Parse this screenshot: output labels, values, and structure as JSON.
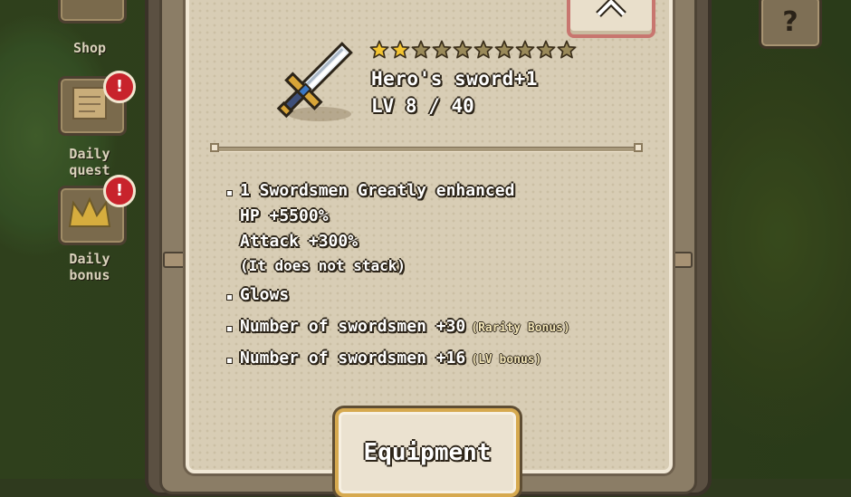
{
  "side_menu": {
    "shop_label": "Shop",
    "daily_quest_label": "Daily quest",
    "daily_bonus_label": "Daily bonus",
    "badge_text": "!"
  },
  "help_button": {
    "label": "?"
  },
  "item": {
    "name": "Hero's sword+1",
    "level": "LV 8 / 40",
    "stars_filled": 2,
    "stars_total": 10
  },
  "effects": {
    "effect1_title": "1 Swordsmen Greatly enhanced",
    "effect1_hp": "HP +5500%",
    "effect1_attack": "Attack +300%",
    "effect1_note": "(It does not stack)",
    "effect2": "Glows",
    "effect3": "Number of swordsmen +30",
    "effect3_bonus": "(Rarity Bonus)",
    "effect4": "Number of swordsmen +16",
    "effect4_bonus": "(LV bonus)"
  },
  "equip_button": {
    "label": "Equipment"
  },
  "colors": {
    "star_filled": "#f4c531",
    "star_empty": "#9a8a5a",
    "badge": "#c8232c",
    "close_border": "#c8766f",
    "equip_border": "#d6a94f"
  }
}
